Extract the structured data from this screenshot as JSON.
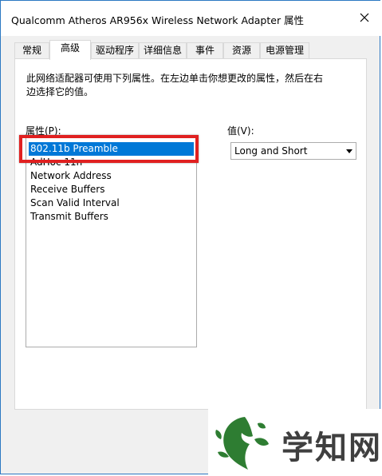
{
  "window": {
    "title": "Qualcomm Atheros AR956x Wireless Network Adapter 属性"
  },
  "tabs": [
    {
      "label": "常规"
    },
    {
      "label": "高级"
    },
    {
      "label": "驱动程序"
    },
    {
      "label": "详细信息"
    },
    {
      "label": "事件"
    },
    {
      "label": "资源"
    },
    {
      "label": "电源管理"
    }
  ],
  "active_tab": "高级",
  "advanced": {
    "description": "此网络适配器可使用下列属性。在左边单击你想更改的属性，然后在右边选择它的值。",
    "property_label": "属性(P):",
    "value_label": "值(V):",
    "properties": [
      {
        "label": "802.11b Preamble"
      },
      {
        "label": "AdHoc 11n"
      },
      {
        "label": "Network Address"
      },
      {
        "label": "Receive Buffers"
      },
      {
        "label": "Scan Valid Interval"
      },
      {
        "label": "Transmit Buffers"
      }
    ],
    "selected_property": "802.11b Preamble",
    "value": "Long and Short"
  },
  "watermark": {
    "text": "学知网"
  },
  "colors": {
    "selection": "#0078d7",
    "highlight": "#e02020",
    "window_border": "#2b78c2",
    "logo_green": "#2e7d32"
  }
}
